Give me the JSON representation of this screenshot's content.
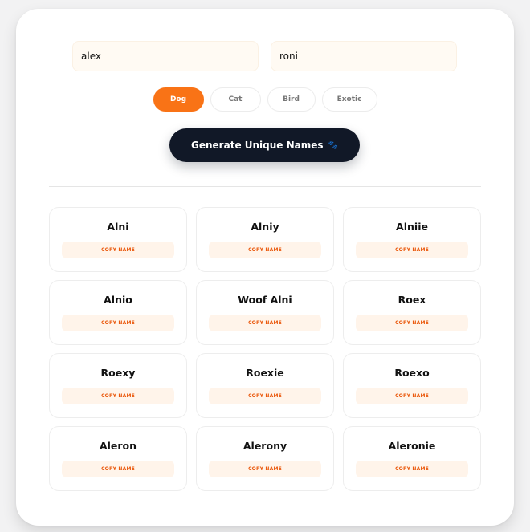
{
  "inputs": {
    "first_value": "alex",
    "second_value": "roni"
  },
  "pet_types": [
    {
      "label": "Dog",
      "active": true
    },
    {
      "label": "Cat",
      "active": false
    },
    {
      "label": "Bird",
      "active": false
    },
    {
      "label": "Exotic",
      "active": false
    }
  ],
  "generate_button": {
    "label": "Generate Unique Names",
    "icon": "paw-icon"
  },
  "names": [
    {
      "name": "Alni",
      "copy_label": "COPY NAME"
    },
    {
      "name": "Alniy",
      "copy_label": "COPY NAME"
    },
    {
      "name": "Alniie",
      "copy_label": "COPY NAME"
    },
    {
      "name": "Alnio",
      "copy_label": "COPY NAME"
    },
    {
      "name": "Woof Alni",
      "copy_label": "COPY NAME"
    },
    {
      "name": "Roex",
      "copy_label": "COPY NAME"
    },
    {
      "name": "Roexy",
      "copy_label": "COPY NAME"
    },
    {
      "name": "Roexie",
      "copy_label": "COPY NAME"
    },
    {
      "name": "Roexo",
      "copy_label": "COPY NAME"
    },
    {
      "name": "Aleron",
      "copy_label": "COPY NAME"
    },
    {
      "name": "Alerony",
      "copy_label": "COPY NAME"
    },
    {
      "name": "Aleronie",
      "copy_label": "COPY NAME"
    }
  ],
  "colors": {
    "accent": "#f97316",
    "button_dark": "#111827",
    "copy_bg": "#fff4ea",
    "copy_text": "#ea580c"
  }
}
